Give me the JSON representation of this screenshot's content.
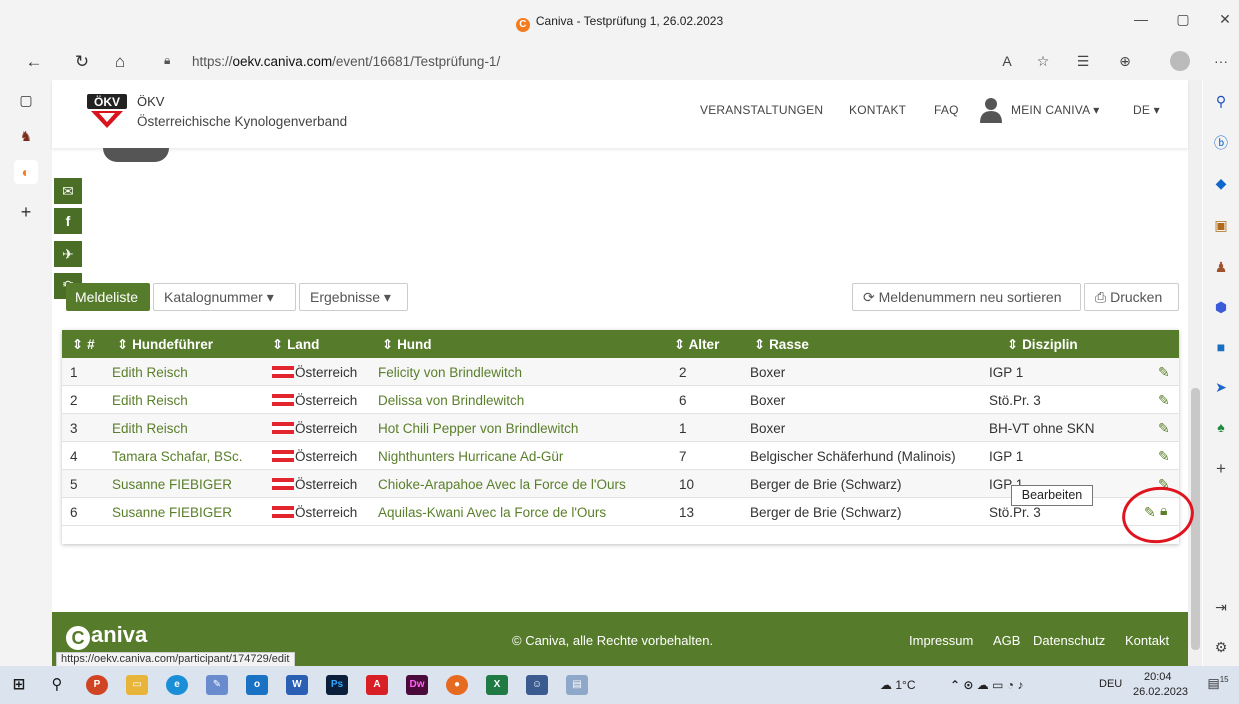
{
  "window": {
    "title": "Caniva - Testprüfung 1, 26.02.2023",
    "logo_glyph": "C"
  },
  "address": {
    "url_prefix": "https://",
    "url_host": "oekv.caniva.com",
    "url_path": "/event/16681/Testprüfung-1/"
  },
  "header": {
    "org_short": "ÖKV",
    "org_name": "Österreichische Kynologenverband",
    "logo_text": "ÖKV",
    "nav": [
      "VERANSTALTUNGEN",
      "KONTAKT",
      "FAQ"
    ],
    "user_menu": "MEIN CANIVA",
    "lang_menu": "DE"
  },
  "toolbar": {
    "tab_active": "Meldeliste",
    "dropdown1": "Katalognummer",
    "dropdown2": "Ergebnisse",
    "resort_button": "Meldenummern neu sortieren",
    "print_button": "Drucken"
  },
  "table": {
    "columns": [
      "#",
      "Hundeführer",
      "Land",
      "Hund",
      "Alter",
      "Rasse",
      "Disziplin"
    ],
    "rows": [
      {
        "nr": "1",
        "handler": "Edith Reisch",
        "country": "Österreich",
        "dog": "Felicity von Brindlewitch",
        "age": "2",
        "breed": "Boxer",
        "discipline": "IGP 1"
      },
      {
        "nr": "2",
        "handler": "Edith Reisch",
        "country": "Österreich",
        "dog": "Delissa von Brindlewitch",
        "age": "6",
        "breed": "Boxer",
        "discipline": "Stö.Pr. 3"
      },
      {
        "nr": "3",
        "handler": "Edith Reisch",
        "country": "Österreich",
        "dog": "Hot Chili Pepper von Brindlewitch",
        "age": "1",
        "breed": "Boxer",
        "discipline": "BH-VT ohne SKN"
      },
      {
        "nr": "4",
        "handler": "Tamara Schafar, BSc.",
        "country": "Österreich",
        "dog": "Nighthunters Hurricane Ad-Gür",
        "age": "7",
        "breed": "Belgischer Schäferhund (Malinois)",
        "discipline": "IGP 1"
      },
      {
        "nr": "5",
        "handler": "Susanne FIEBIGER",
        "country": "Österreich",
        "dog": "Chioke-Arapahoe Avec la Force de l'Ours",
        "age": "10",
        "breed": "Berger de Brie (Schwarz)",
        "discipline": "IGP 1"
      },
      {
        "nr": "6",
        "handler": "Susanne FIEBIGER",
        "country": "Österreich",
        "dog": "Aquilas-Kwani Avec la Force de l'Ours",
        "age": "13",
        "breed": "Berger de Brie (Schwarz)",
        "discipline": "Stö.Pr. 3"
      }
    ],
    "tooltip": "Bearbeiten"
  },
  "footer": {
    "brand": "aniva",
    "brand_glyph": "C",
    "copyright": "© Caniva, alle Rechte vorbehalten.",
    "links": [
      "Impressum",
      "AGB",
      "Datenschutz",
      "Kontakt"
    ]
  },
  "status_url": "https://oekv.caniva.com/participant/174729/edit",
  "taskbar": {
    "temperature": "1°C",
    "language": "DEU",
    "time": "20:04",
    "date": "26.02.2023",
    "notifications": "15"
  },
  "colors": {
    "brand_green": "#567c2b",
    "link_green": "#5a7f2a",
    "highlight_red": "#e0141e"
  }
}
